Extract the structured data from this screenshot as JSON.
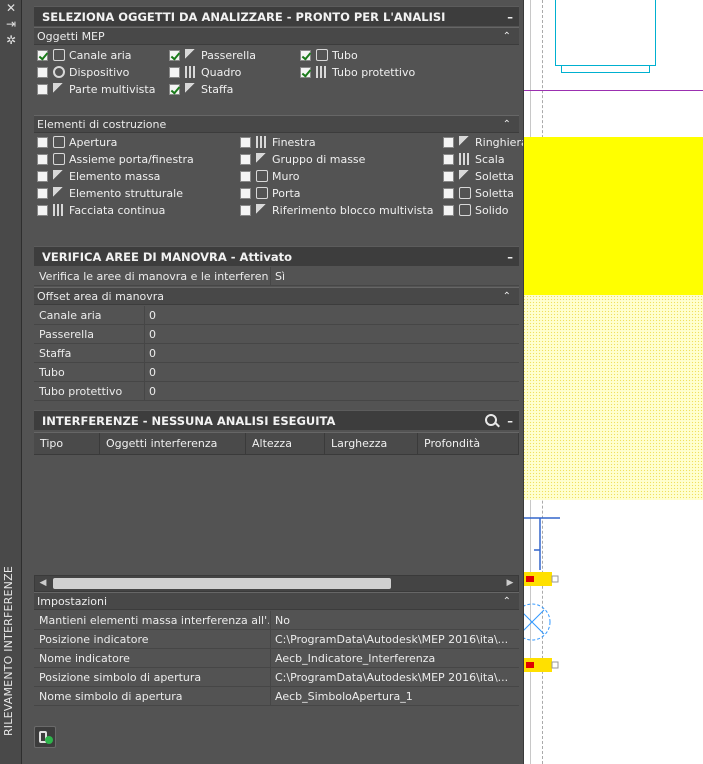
{
  "palette_title": "RILEVAMENTO INTERFERENZE",
  "left_bar_icons": [
    "close-icon",
    "autohide-icon",
    "properties-icon"
  ],
  "section1": {
    "title": "SELEZIONA OGGETTI DA ANALIZZARE - PRONTO PER L'ANALISI",
    "mep_header": "Oggetti MEP",
    "mep_items": [
      {
        "label": "Canale aria",
        "checked": true
      },
      {
        "label": "Passerella",
        "checked": true
      },
      {
        "label": "Tubo",
        "checked": true
      },
      {
        "label": "Dispositivo",
        "checked": false
      },
      {
        "label": "Quadro",
        "checked": false
      },
      {
        "label": "Tubo protettivo",
        "checked": true
      },
      {
        "label": "Parte multivista",
        "checked": false
      },
      {
        "label": "Staffa",
        "checked": true
      }
    ],
    "build_header": "Elementi di costruzione",
    "build_items": [
      {
        "label": "Apertura",
        "checked": false
      },
      {
        "label": "Finestra",
        "checked": false
      },
      {
        "label": "Ringhiera",
        "checked": false
      },
      {
        "label": "Assieme porta/finestra",
        "checked": false
      },
      {
        "label": "Gruppo di masse",
        "checked": false
      },
      {
        "label": "Scala",
        "checked": false
      },
      {
        "label": "Elemento massa",
        "checked": false
      },
      {
        "label": "Muro",
        "checked": false
      },
      {
        "label": "Soletta",
        "checked": false
      },
      {
        "label": "Elemento strutturale",
        "checked": false
      },
      {
        "label": "Porta",
        "checked": false
      },
      {
        "label": "Soletta",
        "checked": false
      },
      {
        "label": "Facciata continua",
        "checked": false
      },
      {
        "label": "Riferimento blocco multivista",
        "checked": false
      },
      {
        "label": "Solido",
        "checked": false
      }
    ]
  },
  "section2": {
    "title": "VERIFICA AREE DI MANOVRA - Attivato",
    "check_label": "Verifica le aree di manovra e le interferen...",
    "check_value": "Sì",
    "offset_header": "Offset area di manovra",
    "offsets": [
      {
        "label": "Canale aria",
        "value": "0"
      },
      {
        "label": "Passerella",
        "value": "0"
      },
      {
        "label": "Staffa",
        "value": "0"
      },
      {
        "label": "Tubo",
        "value": "0"
      },
      {
        "label": "Tubo protettivo",
        "value": "0"
      }
    ]
  },
  "section3": {
    "title": "INTERFERENZE - NESSUNA ANALISI ESEGUITA",
    "columns": [
      "Tipo",
      "Oggetti interferenza",
      "Altezza",
      "Larghezza",
      "Profondità"
    ],
    "settings_header": "Impostazioni",
    "settings": [
      {
        "label": "Mantieni elementi massa interferenza all'...",
        "value": "No"
      },
      {
        "label": "Posizione indicatore",
        "value": "C:\\ProgramData\\Autodesk\\MEP 2016\\ita\\..."
      },
      {
        "label": "Nome indicatore",
        "value": "Aecb_Indicatore_Interferenza"
      },
      {
        "label": "Posizione simbolo di apertura",
        "value": "C:\\ProgramData\\Autodesk\\MEP 2016\\ita\\..."
      },
      {
        "label": "Nome simbolo di apertura",
        "value": "Aecb_SimboloApertura_1"
      }
    ]
  },
  "glyphs": {
    "close": "✕",
    "autohide": "⇥",
    "properties": "✲",
    "minus": "–",
    "caret_up": "⌃",
    "scroll_left": "◀",
    "scroll_right": "▶"
  }
}
